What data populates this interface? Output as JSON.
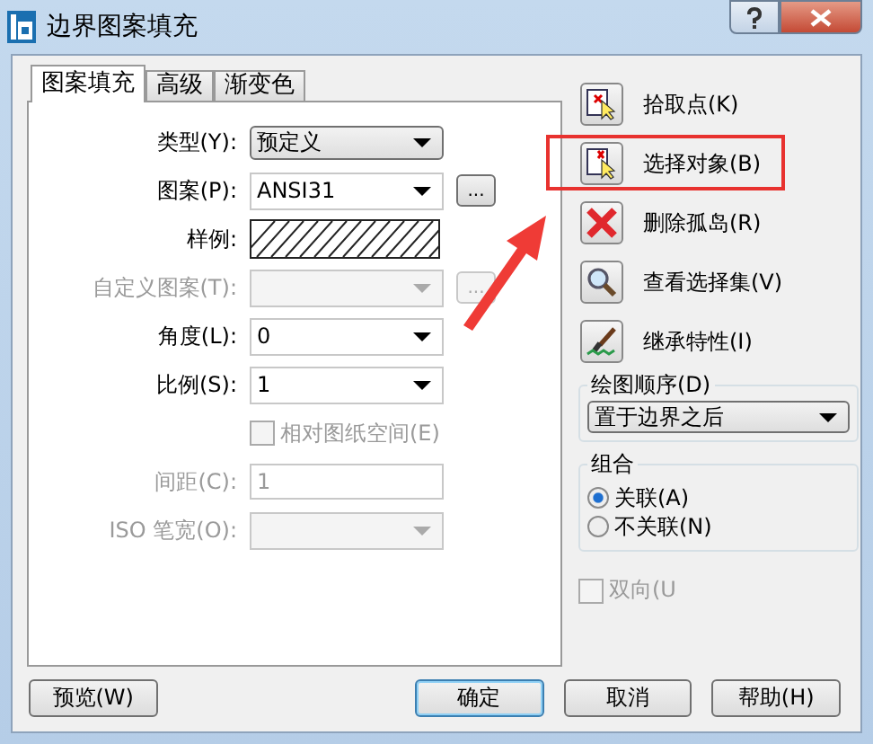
{
  "window": {
    "title": "边界图案填充"
  },
  "tabs": [
    {
      "label": "图案填充",
      "selected": true
    },
    {
      "label": "高级",
      "selected": false
    },
    {
      "label": "渐变色",
      "selected": false
    }
  ],
  "fields": [
    {
      "kind": "select",
      "label": "类型(Y):",
      "value": "预定义",
      "disabled": false
    },
    {
      "kind": "combo",
      "label": "图案(P):",
      "value": "ANSI31",
      "disabled": false,
      "browse": "..."
    },
    {
      "kind": "swatch",
      "label": "样例:",
      "disabled": false
    },
    {
      "kind": "combo",
      "label": "自定义图案(T):",
      "disabled": true,
      "browse": "..."
    },
    {
      "kind": "combo",
      "label": "角度(L):",
      "value": "0",
      "disabled": false
    },
    {
      "kind": "combo",
      "label": "比例(S):",
      "value": "1",
      "disabled": false
    },
    {
      "kind": "checkbox",
      "label": "相对图纸空间(E)",
      "checked": false,
      "disabled": true
    },
    {
      "kind": "text",
      "label": "间距(C):",
      "value": "1",
      "disabled": true
    },
    {
      "kind": "combo",
      "label": "ISO 笔宽(O):",
      "disabled": true
    }
  ],
  "actions": [
    {
      "kind": "pick",
      "label": "拾取点(K)",
      "highlighted": false
    },
    {
      "kind": "select",
      "label": "选择对象(B)",
      "highlighted": true
    },
    {
      "kind": "delete",
      "label": "删除孤岛(R)",
      "highlighted": false
    },
    {
      "kind": "view",
      "label": "查看选择集(V)",
      "highlighted": false
    },
    {
      "kind": "inherit",
      "label": "继承特性(I)",
      "highlighted": false
    }
  ],
  "draw_order": {
    "legend": "绘图顺序(D)",
    "value": "置于边界之后"
  },
  "association": {
    "legend": "组合",
    "options": [
      {
        "label": "关联(A)",
        "selected": true
      },
      {
        "label": "不关联(N)",
        "selected": false
      }
    ]
  },
  "bidirectional": {
    "label": "双向(U",
    "checked": false,
    "disabled": true
  },
  "footer_buttons": [
    {
      "label": "预览(W)",
      "default": false
    },
    {
      "label": "确定",
      "default": true
    },
    {
      "label": "取消",
      "default": false
    },
    {
      "label": "帮助(H)",
      "default": false
    }
  ]
}
